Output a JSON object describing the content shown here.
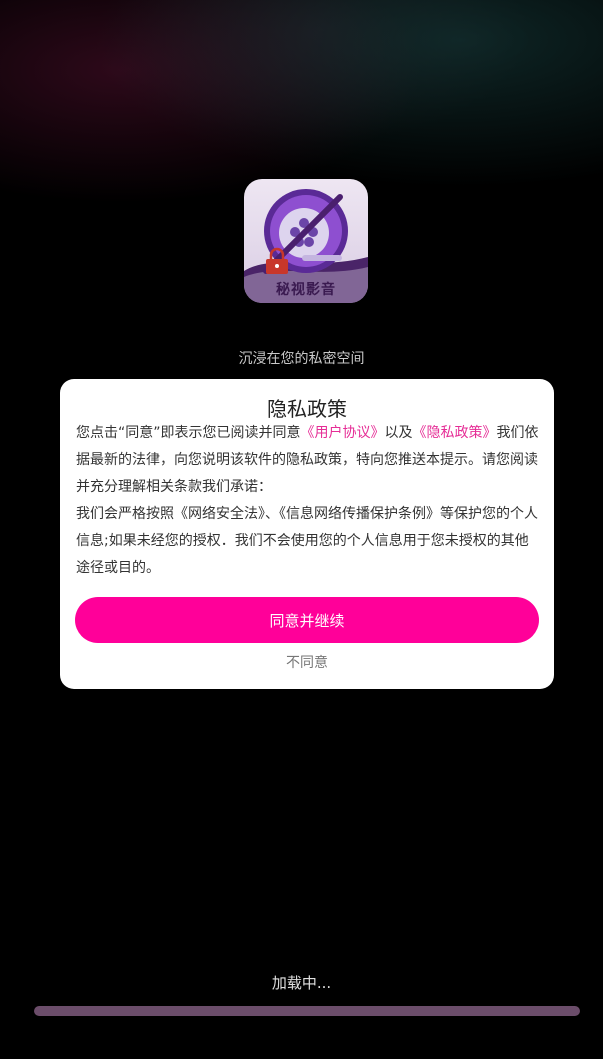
{
  "app": {
    "logo_text": "秘视影音",
    "tagline": "沉浸在您的私密空间"
  },
  "dialog": {
    "title": "隐私政策",
    "paragraph1": {
      "before": "您点击“同意”即表示您已阅读并同意",
      "user_agreement_link": "《用户协议》",
      "between": "以及",
      "privacy_policy_link": "《隐私政策》",
      "after": "我们依据最新的法律，向您说明该软件的隐私政策，特向您推送本提示。请您阅读并充分理解相关条款我们承诺："
    },
    "paragraph2": "我们会严格按照《网络安全法》、《信息网络传播保护条例》等保护您的个人信息;如果未经您的授权．我们不会使用您的个人信息用于您未授权的其他途径或目的。",
    "agree_button": "同意并继续",
    "disagree_button": "不同意"
  },
  "loading": {
    "text": "加载中...",
    "progress_percent": 100
  },
  "colors": {
    "accent": "#ff0099",
    "link": "#e62d96",
    "progress_fill": "#6b4d6a",
    "progress_track": "#3d2434",
    "logo_purple": "#7a3db8"
  },
  "icons": {
    "app_logo": "film-reel-icon",
    "lock": "lock-icon"
  }
}
